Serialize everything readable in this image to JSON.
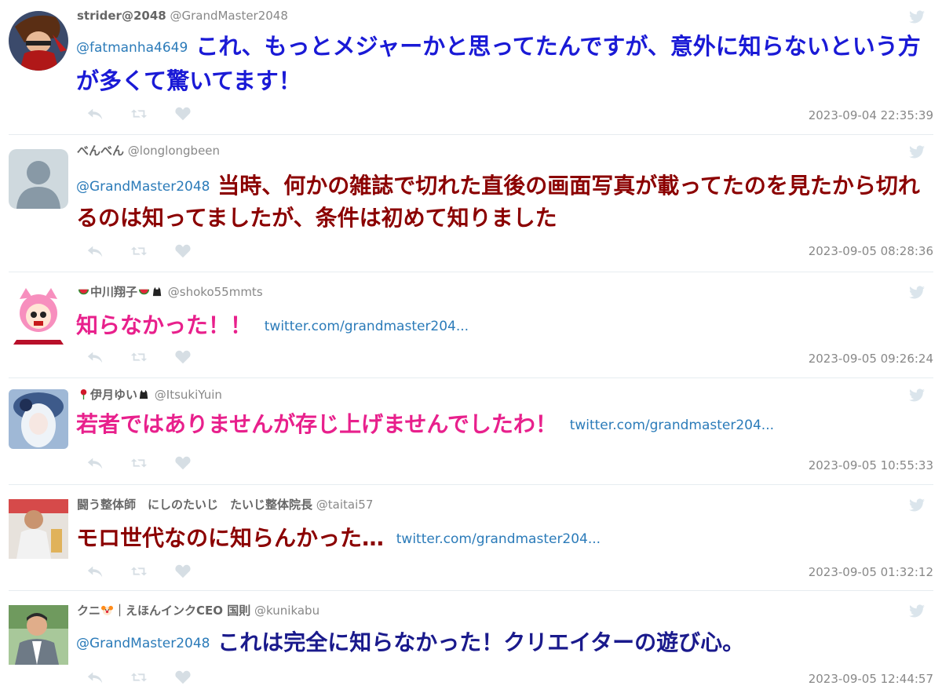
{
  "feed": {
    "tweets": [
      {
        "name": "strider@2048",
        "handle": "@GrandMaster2048",
        "mention": "@fatmanha4649",
        "text": "これ、もっとメジャーかと思ってたんですが、意外に知らないという方が多くて驚いてます！",
        "text_color": "#1a1ad6",
        "link": "",
        "date": "2023-09-04 22:35:39"
      },
      {
        "name": "べんべん",
        "handle": "@longlongbeen",
        "mention": "@GrandMaster2048",
        "text": "当時、何かの雑誌で切れた直後の画面写真が載ってたのを見たから切れるのは知ってましたが、条件は初めて知りました",
        "text_color": "#8b0000",
        "link": "",
        "date": "2023-09-05 08:28:36"
      },
      {
        "name": "中川翔子",
        "name_emojis": [
          "watermelon",
          "watermelon",
          "cat"
        ],
        "handle": "@shoko55mmts",
        "mention": "",
        "text": "知らなかった！！",
        "text_color": "#e8208c",
        "link": "twitter.com/grandmaster204...",
        "date": "2023-09-05 09:26:24"
      },
      {
        "name": "伊月ゆい",
        "name_emojis": [
          "rose",
          "cat"
        ],
        "handle": "@ItsukiYuin",
        "mention": "",
        "text": "若者ではありませんが存じ上げませんでしたわ！",
        "text_color": "#e8208c",
        "link": "twitter.com/grandmaster204...",
        "date": "2023-09-05 10:55:33"
      },
      {
        "name": "闘う整体師　にしのたいじ　たいじ整体院長",
        "handle": "@taitai57",
        "mention": "",
        "text": "モロ世代なのに知らんかった…",
        "text_color": "#8b0000",
        "link": "twitter.com/grandmaster204...",
        "date": "2023-09-05 01:32:12"
      },
      {
        "name_pre": "クニ",
        "name_post": "｜えほんインクCEO 国則",
        "name_emojis": [
          "clown"
        ],
        "handle": "@kunikabu",
        "mention": "@GrandMaster2048",
        "text": "これは完全に知らなかった！クリエイターの遊び心。",
        "text_color": "#1a1a8c",
        "link": "",
        "date": "2023-09-05 12:44:57"
      }
    ]
  },
  "icons": {
    "reply": "reply-icon",
    "retweet": "retweet-icon",
    "like": "heart-icon",
    "brand": "twitter-bird-icon"
  },
  "colors": {
    "link": "#2b7bb9",
    "meta": "#888888",
    "action": "#d6dee4"
  }
}
